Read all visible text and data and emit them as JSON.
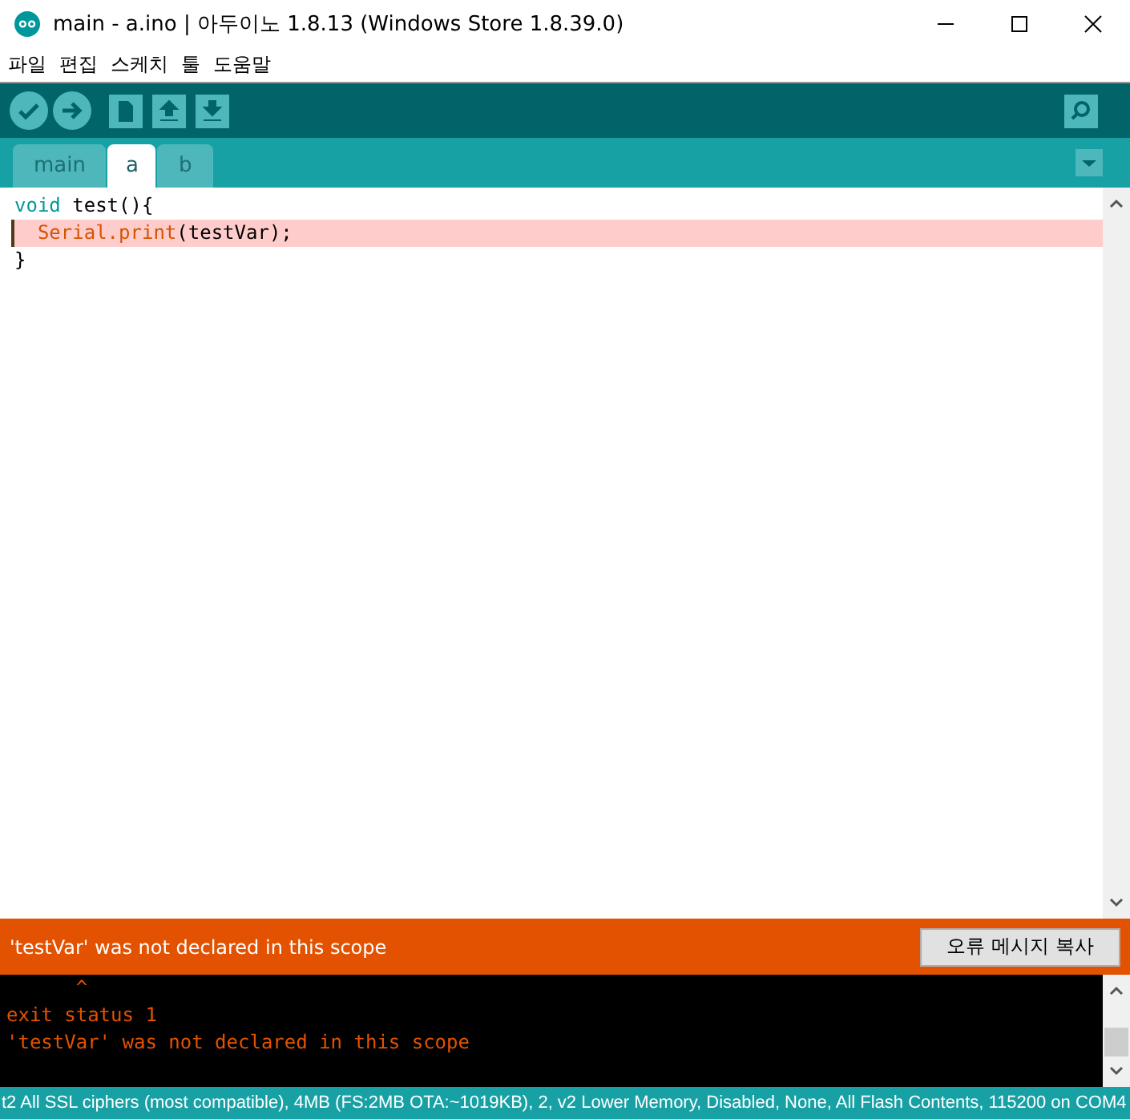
{
  "window": {
    "title": "main - a.ino | 아두이노 1.8.13 (Windows Store 1.8.39.0)"
  },
  "menu": [
    "파일",
    "편집",
    "스케치",
    "툴",
    "도움말"
  ],
  "tabs": [
    {
      "label": "main",
      "selected": false
    },
    {
      "label": "a",
      "selected": true
    },
    {
      "label": "b",
      "selected": false
    }
  ],
  "code_lines": [
    {
      "highlighted": false,
      "tokens": [
        {
          "kind": "keyword",
          "text": "void"
        },
        {
          "kind": "plain",
          "text": " test(){"
        }
      ]
    },
    {
      "highlighted": true,
      "tokens": [
        {
          "kind": "class",
          "text": "  Serial"
        },
        {
          "kind": "class",
          "text": ".print"
        },
        {
          "kind": "plain",
          "text": "(testVar);"
        }
      ]
    },
    {
      "highlighted": false,
      "tokens": [
        {
          "kind": "plain",
          "text": "}"
        }
      ]
    }
  ],
  "error_bar": {
    "message": "'testVar' was not declared in this scope",
    "copy_button": "오류 메시지 복사"
  },
  "console_lines": [
    "      ^",
    "exit status 1",
    "'testVar' was not declared in this scope"
  ],
  "status_bar": "t2 All SSL ciphers (most compatible), 4MB (FS:2MB OTA:~1019KB), 2, v2 Lower Memory, Disabled, None, All Flash Contents, 115200 on COM4"
}
